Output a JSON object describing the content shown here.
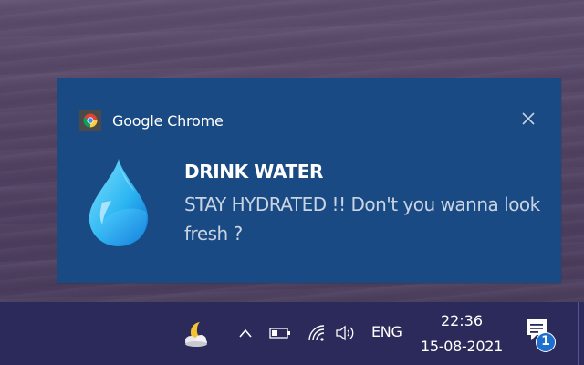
{
  "notification": {
    "app_name": "Google Chrome",
    "title": "DRINK WATER",
    "body": "STAY HYDRATED !! Don't you wanna look fresh ?",
    "app_icon": "chrome-icon",
    "image_icon": "water-drop-icon",
    "close_icon": "close-icon",
    "background_color": "#1a4a84"
  },
  "taskbar": {
    "background_color": "#2b2a5a",
    "tray_icons": [
      "weather-moon-cloud-icon",
      "chevron-up-icon",
      "battery-icon",
      "wifi-icon",
      "volume-icon"
    ],
    "language": "ENG",
    "time": "22:36",
    "date": "15-08-2021",
    "notification_count": "1",
    "notification_icon": "action-center-icon"
  }
}
